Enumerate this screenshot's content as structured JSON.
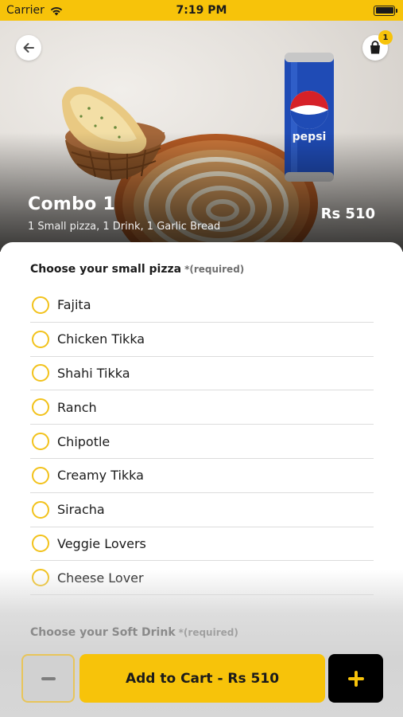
{
  "status_bar": {
    "carrier": "Carrier",
    "time": "7:19 PM"
  },
  "hero": {
    "title": "Combo 1",
    "description": "1 Small pizza, 1 Drink, 1 Garlic Bread",
    "price": "Rs 510",
    "cart_count": "1",
    "can_brand": "pepsi"
  },
  "pizza_section": {
    "title": "Choose your small pizza",
    "required_text": "*(required)",
    "options": [
      "Fajita",
      "Chicken Tikka",
      "Shahi Tikka",
      "Ranch",
      "Chipotle",
      "Creamy Tikka",
      "Siracha",
      "Veggie Lovers",
      "Cheese Lover"
    ]
  },
  "drink_section": {
    "title": "Choose your Soft Drink",
    "required_text": "*(required)"
  },
  "actions": {
    "add_to_cart_label": "Add to Cart - Rs 510"
  },
  "colors": {
    "accent": "#f7c30a",
    "radio_border": "#f2c21b",
    "dark_button": "#000000"
  }
}
